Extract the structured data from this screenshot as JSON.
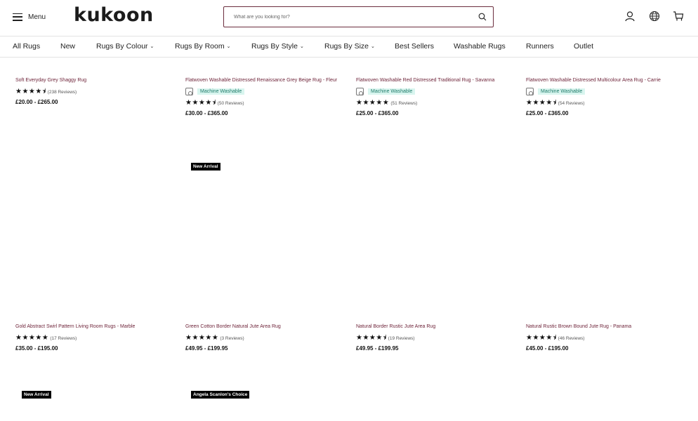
{
  "header": {
    "menu_label": "Menu",
    "logo": "kukoon",
    "search_placeholder": "What are you looking for?"
  },
  "nav": [
    {
      "label": "All Rugs",
      "chevron": ""
    },
    {
      "label": "New",
      "chevron": ""
    },
    {
      "label": "Rugs By Colour",
      "chevron": "⌄"
    },
    {
      "label": "Rugs By Room",
      "chevron": "⌄"
    },
    {
      "label": "Rugs By Style",
      "chevron": "⌄"
    },
    {
      "label": "Rugs By Size",
      "chevron": "⌄"
    },
    {
      "label": "Best Sellers",
      "chevron": ""
    },
    {
      "label": "Washable Rugs",
      "chevron": ""
    },
    {
      "label": "Runners",
      "chevron": ""
    },
    {
      "label": "Outlet",
      "chevron": ""
    }
  ],
  "products": [
    {
      "title": "Soft Everyday Grey Shaggy Rug",
      "washable": "",
      "stars": "★★★★⯨",
      "reviews": "(238 Reviews)",
      "price": "£20.00 - £265.00"
    },
    {
      "title": "Flatwoven Washable Distressed Renaissance Grey Beige Rug - Fleur",
      "washable": "Machine Washable",
      "stars": "★★★★⯨",
      "reviews": "(50 Reviews)",
      "price": "£30.00 - £365.00"
    },
    {
      "title": "Flatwoven Washable Red Distressed Traditional Rug - Savanna",
      "washable": "Machine Washable",
      "stars": "★★★★★",
      "reviews": "(51 Reviews)",
      "price": "£25.00 - £365.00"
    },
    {
      "title": "Flatwoven Washable Distressed Multicolour Area Rug - Carrie",
      "washable": "Machine Washable",
      "stars": "★★★★⯨",
      "reviews": "(54 Reviews)",
      "price": "£25.00 - £365.00"
    },
    {
      "title": "Gold Abstract Swirl Pattern Living Room Rugs - Marble",
      "washable": "",
      "stars": "★★★★★",
      "reviews": "(17 Reviews)",
      "price": "£35.00 - £195.00"
    },
    {
      "title": "Green Cotton Border Natural Jute Area Rug",
      "washable": "",
      "stars": "★★★★★",
      "reviews": "(3 Reviews)",
      "price": "£49.95 - £199.95"
    },
    {
      "title": "Natural Border Rustic Jute Area Rug",
      "washable": "",
      "stars": "★★★★⯨",
      "reviews": "(19 Reviews)",
      "price": "£49.95 - £199.95"
    },
    {
      "title": "Natural Rustic Brown Bound Jute Rug - Panama",
      "washable": "",
      "stars": "★★★★⯨",
      "reviews": "(46 Reviews)",
      "price": "£45.00 - £195.00"
    }
  ],
  "tags": {
    "new_arrival_1": "New Arrival",
    "new_arrival_2": "New Arrival",
    "choice": "Angela Scanlon's Choice"
  },
  "icons": {
    "menu": "hamburger-icon",
    "search": "search-icon",
    "account": "user-icon",
    "region": "globe-icon",
    "basket": "cart-icon"
  },
  "colors": {
    "title": "#6b1f35",
    "search_border": "#6b2e3e",
    "washable_bg": "#d9f5ef",
    "washable_text": "#1f7c6a"
  }
}
